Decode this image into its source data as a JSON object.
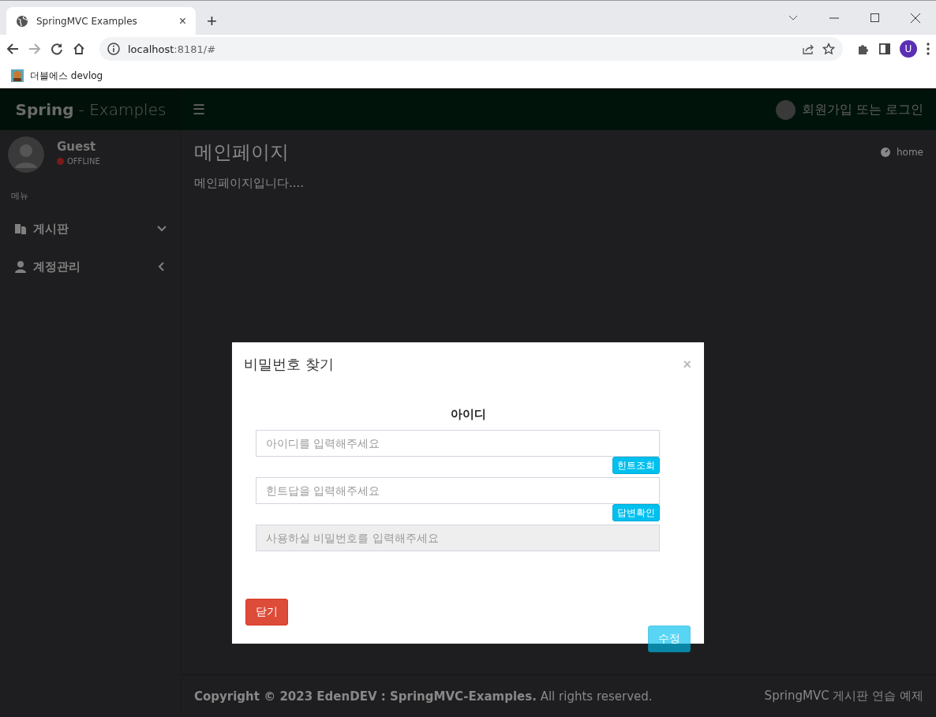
{
  "browser": {
    "tab_title": "SpringMVC Examples",
    "tab_close": "×",
    "new_tab": "+",
    "url_host": "localhost",
    "url_rest": ":8181/#",
    "bookmark": "더블에스 devlog",
    "profile": "U"
  },
  "header": {
    "brand_bold": "Spring",
    "brand_rest": "- Examples",
    "menu_toggle": "☰",
    "user_link": "회원가입 또는 로그인"
  },
  "sidebar": {
    "user_name": "Guest",
    "status": "OFFLINE",
    "menu_header": "메뉴",
    "items": [
      {
        "label": "게시판",
        "kind": "files",
        "expanded": true
      },
      {
        "label": "계정관리",
        "kind": "user",
        "expanded": false
      }
    ]
  },
  "content": {
    "title": "메인페이지",
    "breadcrumb": "home",
    "body": "메인페이지입니다...."
  },
  "footer": {
    "copyright": "**Copyright © 2023 EdenDEV : SpringMVC-Examples.** All rights reserved.",
    "right": "SpringMVC 게시판 연습 예제"
  },
  "modal": {
    "title": "비밀번호 찾기",
    "close": "×",
    "label": "아이디",
    "fields": [
      {
        "placeholder": "아이디를 입력해주세요",
        "disabled": false,
        "button": "힌트조회"
      },
      {
        "placeholder": "힌트답을 입력해주세요",
        "disabled": false,
        "button": "답변확인"
      },
      {
        "placeholder": "사용하실 비밀번호를 입력해주세요",
        "disabled": true
      }
    ],
    "close_button": "닫기",
    "submit": {
      "label": "수정",
      "disabled": true
    }
  }
}
